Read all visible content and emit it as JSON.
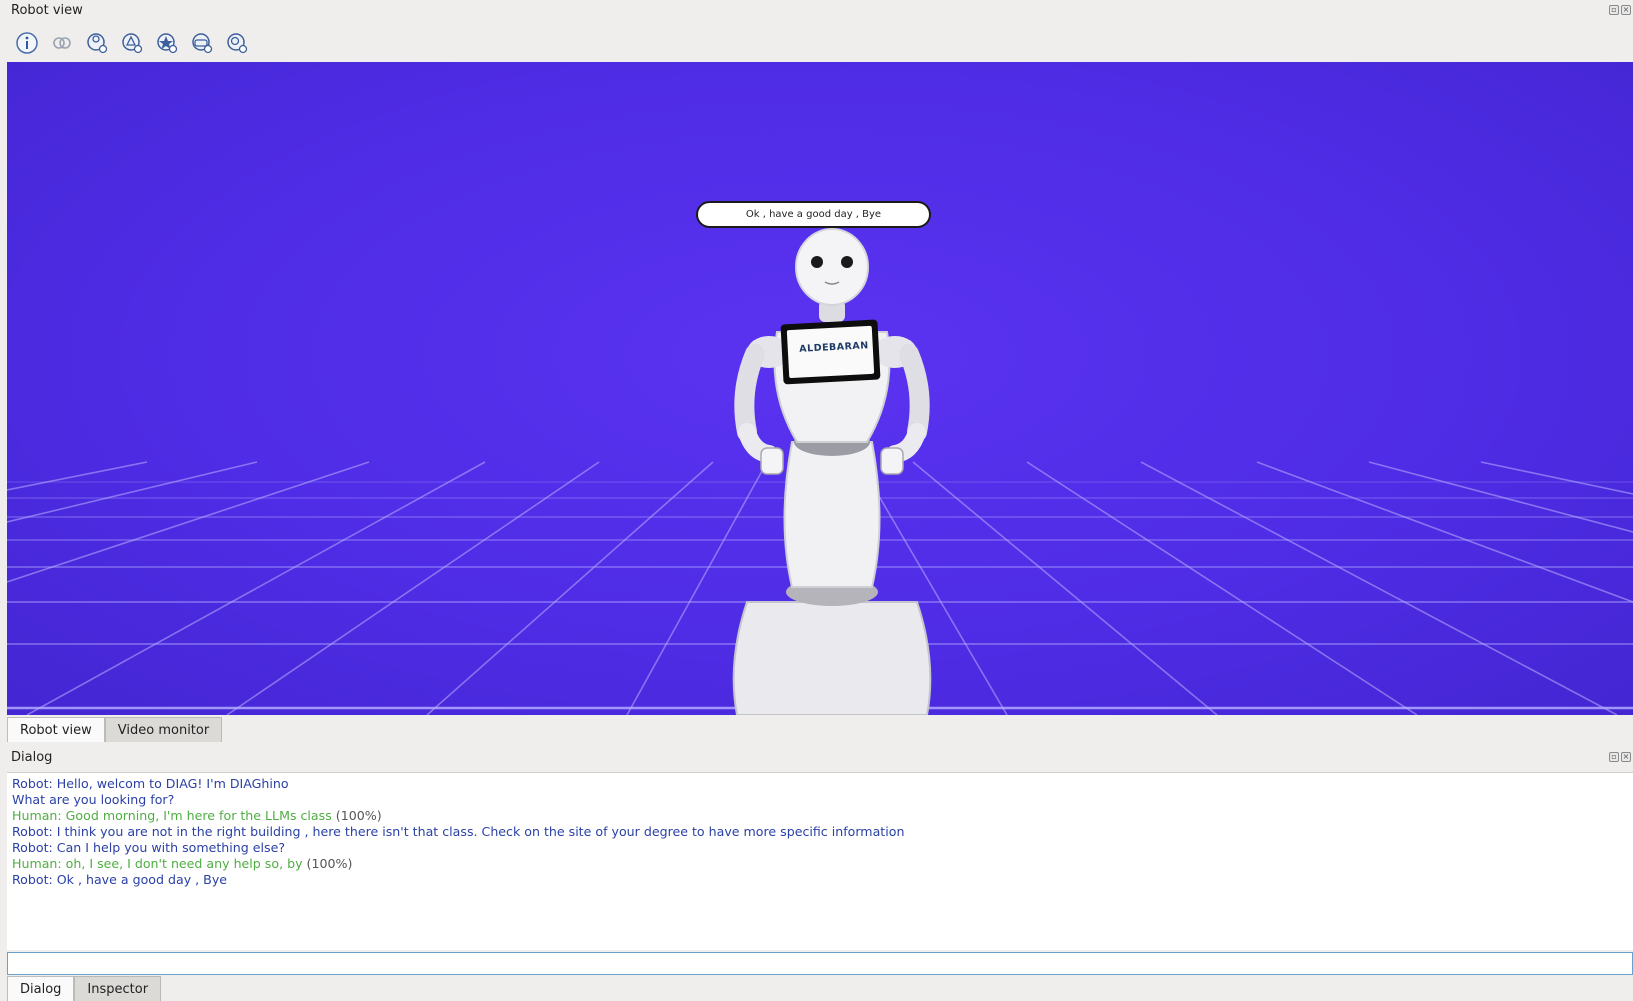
{
  "robot_view_panel": {
    "title": "Robot view"
  },
  "toolbar": {
    "buttons": [
      {
        "name": "info-icon"
      },
      {
        "name": "link-icon"
      },
      {
        "name": "robot-settings-icon"
      },
      {
        "name": "robot-animation-icon"
      },
      {
        "name": "robot-behavior-icon"
      },
      {
        "name": "robot-camera-icon"
      },
      {
        "name": "robot-search-icon"
      }
    ]
  },
  "scene": {
    "speech_bubble": "Ok , have a good day , Bye",
    "tablet_logo": "ALDEBARAN",
    "background_color": "#4f2ce6"
  },
  "top_tabs": {
    "robot_view": "Robot view",
    "video_monitor": "Video monitor"
  },
  "dialog_panel": {
    "title": "Dialog",
    "lines": [
      {
        "speaker": "robot",
        "text": "Robot: Hello, welcom to DIAG! I'm DIAGhino",
        "confidence": ""
      },
      {
        "speaker": "robot",
        "text": "What are you looking for?",
        "confidence": ""
      },
      {
        "speaker": "human",
        "text": "Human: Good morning, I'm here for the LLMs class",
        "confidence": "(100%)"
      },
      {
        "speaker": "robot",
        "text": "Robot: I think you are not in the right building , here there isn't that class. Check on the site of your degree to have more specific information",
        "confidence": ""
      },
      {
        "speaker": "robot",
        "text": "Robot: Can I help you with something else?",
        "confidence": ""
      },
      {
        "speaker": "human",
        "text": "Human: oh, I see, I don't need any help so, by",
        "confidence": "(100%)"
      },
      {
        "speaker": "robot",
        "text": "Robot: Ok , have a good day , Bye",
        "confidence": ""
      }
    ],
    "input_value": ""
  },
  "bottom_tabs": {
    "dialog": "Dialog",
    "inspector": "Inspector"
  },
  "colors": {
    "robot_text": "#2b41a7",
    "human_text": "#4fae43"
  }
}
